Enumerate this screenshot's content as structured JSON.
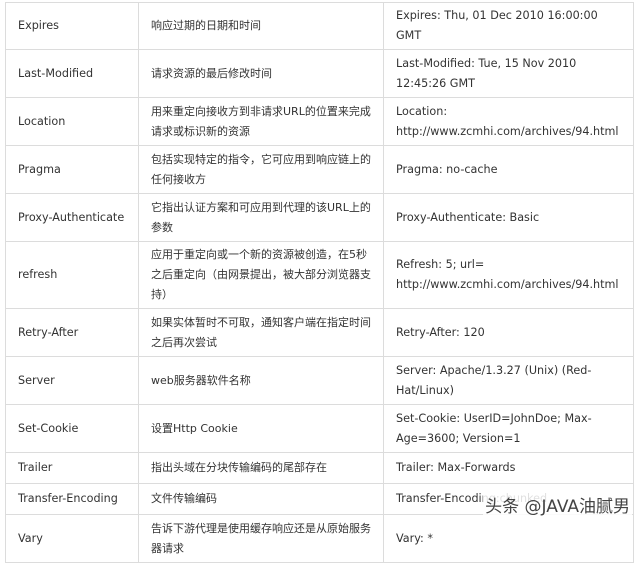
{
  "table": {
    "rows": [
      {
        "name": "Expires",
        "description": "响应过期的日期和时间",
        "example": "Expires: Thu, 01 Dec 2010 16:00:00 GMT"
      },
      {
        "name": "Last-Modified",
        "description": "请求资源的最后修改时间",
        "example": "Last-Modified: Tue, 15 Nov 2010 12:45:26 GMT"
      },
      {
        "name": "Location",
        "description": "用来重定向接收方到非请求URL的位置来完成请求或标识新的资源",
        "example": "Location: http://www.zcmhi.com/archives/94.html"
      },
      {
        "name": "Pragma",
        "description": "包括实现特定的指令，它可应用到响应链上的任何接收方",
        "example": "Pragma: no-cache"
      },
      {
        "name": "Proxy-Authenticate",
        "description": "它指出认证方案和可应用到代理的该URL上的参数",
        "example": "Proxy-Authenticate: Basic"
      },
      {
        "name": "refresh",
        "description": "应用于重定向或一个新的资源被创造，在5秒之后重定向（由网景提出，被大部分浏览器支持）",
        "example": "Refresh: 5; url= http://www.zcmhi.com/archives/94.html"
      },
      {
        "name": "Retry-After",
        "description": "如果实体暂时不可取，通知客户端在指定时间之后再次尝试",
        "example": "Retry-After: 120"
      },
      {
        "name": "Server",
        "description": "web服务器软件名称",
        "example": "Server: Apache/1.3.27 (Unix) (Red-Hat/Linux)"
      },
      {
        "name": "Set-Cookie",
        "description": "设置Http Cookie",
        "example": "Set-Cookie: UserID=JohnDoe; Max-Age=3600; Version=1"
      },
      {
        "name": "Trailer",
        "description": "指出头域在分块传输编码的尾部存在",
        "example": "Trailer: Max-Forwards"
      },
      {
        "name": "Transfer-Encoding",
        "description": "文件传输编码",
        "example": "Transfer-Encoding:chunked"
      },
      {
        "name": "Vary",
        "description": "告诉下游代理是使用缓存响应还是从原始服务器请求",
        "example": "Vary: *"
      }
    ]
  },
  "watermark": "头条 @JAVA油腻男"
}
